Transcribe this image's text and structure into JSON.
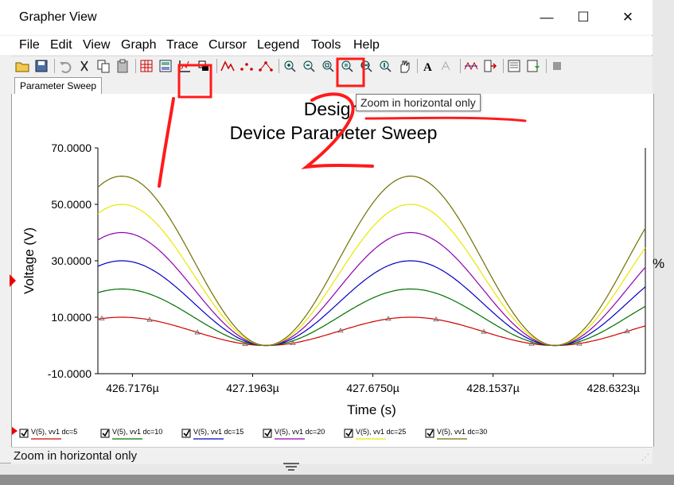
{
  "window": {
    "title": "Grapher View",
    "minimize": "—",
    "maximize": "☐",
    "close": "✕"
  },
  "menu": [
    "File",
    "Edit",
    "View",
    "Graph",
    "Trace",
    "Cursor",
    "Legend",
    "Tools",
    "Help"
  ],
  "toolbar": [
    {
      "name": "open-icon"
    },
    {
      "name": "save-icon"
    },
    {
      "sep": true
    },
    {
      "name": "undo-icon"
    },
    {
      "name": "cut-icon"
    },
    {
      "name": "copy-icon"
    },
    {
      "name": "paste-icon"
    },
    {
      "sep": true
    },
    {
      "name": "grid-icon"
    },
    {
      "name": "legend-toggle-icon"
    },
    {
      "name": "axis-icon"
    },
    {
      "name": "box-toggle-icon"
    },
    {
      "sep": true
    },
    {
      "name": "trace-line-icon"
    },
    {
      "name": "trace-points-icon"
    },
    {
      "name": "trace-line-points-icon"
    },
    {
      "sep": true
    },
    {
      "name": "zoom-in-icon"
    },
    {
      "name": "zoom-out-icon"
    },
    {
      "name": "zoom-region-icon"
    },
    {
      "name": "zoom-fit-icon"
    },
    {
      "name": "zoom-horizontal-icon"
    },
    {
      "name": "zoom-vertical-icon"
    },
    {
      "name": "pan-hand-icon"
    },
    {
      "sep": true
    },
    {
      "name": "text-annotation-icon"
    },
    {
      "name": "label-icon"
    },
    {
      "sep": true
    },
    {
      "name": "cursor-trace-icon"
    },
    {
      "name": "export-icon"
    },
    {
      "sep": true
    },
    {
      "name": "properties-icon"
    },
    {
      "name": "refresh-icon"
    },
    {
      "sep": true
    },
    {
      "name": "stop-icon"
    }
  ],
  "tab": "Parameter Sweep",
  "tooltip": "Zoom in horizontal only",
  "status": "Zoom in horizontal only",
  "percent_fragment": "%",
  "colors": {
    "accent_annotation": "#ff0000",
    "axis": "#000000"
  },
  "chart_data": {
    "type": "line",
    "title": "Design1",
    "title_shown": "Desigr",
    "subtitle": "Device Parameter Sweep",
    "xlabel": "Time (s)",
    "ylabel": "Voltage (V)",
    "x_ticks": [
      "426.7176µ",
      "427.1963µ",
      "427.6750µ",
      "428.1537µ",
      "428.6323µ"
    ],
    "y_ticks": [
      "70.0000",
      "50.0000",
      "30.0000",
      "10.0000",
      "-10.0000"
    ],
    "xlim": [
      426.58,
      428.76
    ],
    "ylim": [
      -10,
      70
    ],
    "grid": false,
    "legend_position": "bottom",
    "series": [
      {
        "name": "V(5), vv1 dc=5",
        "color": "#d00000",
        "amplitude": 5,
        "markers": true
      },
      {
        "name": "V(5), vv1 dc=10",
        "color": "#007000",
        "amplitude": 10
      },
      {
        "name": "V(5), vv1 dc=15",
        "color": "#0000c0",
        "amplitude": 15
      },
      {
        "name": "V(5), vv1 dc=20",
        "color": "#9000b0",
        "amplitude": 20
      },
      {
        "name": "V(5), vv1 dc=25",
        "color": "#e8e800",
        "amplitude": 25
      },
      {
        "name": "V(5), vv1 dc=30",
        "color": "#707000",
        "amplitude": 30
      }
    ],
    "waveform": {
      "offset_factor": 1,
      "min": 0,
      "minima_x": [
        427.25,
        428.4
      ],
      "period": 1.15
    }
  }
}
